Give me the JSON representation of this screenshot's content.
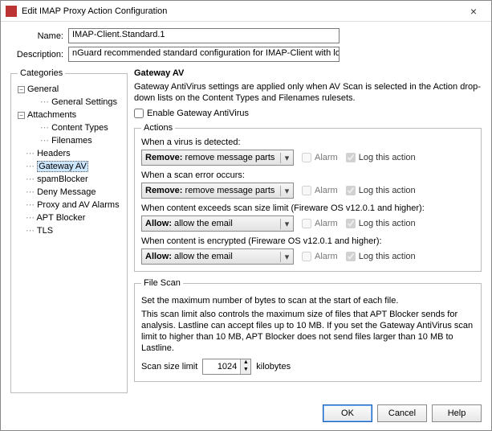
{
  "window": {
    "title": "Edit IMAP Proxy Action Configuration"
  },
  "fields": {
    "name_label": "Name:",
    "name_value": "IMAP-Client.Standard.1",
    "desc_label": "Description:",
    "desc_value": "nGuard recommended standard configuration for IMAP-Client with logging enabled"
  },
  "categories": {
    "legend": "Categories",
    "items": {
      "general": "General",
      "general_settings": "General Settings",
      "attachments": "Attachments",
      "content_types": "Content Types",
      "filenames": "Filenames",
      "headers": "Headers",
      "gateway_av": "Gateway AV",
      "spamblocker": "spamBlocker",
      "deny_message": "Deny Message",
      "proxy_av_alarms": "Proxy and AV Alarms",
      "apt_blocker": "APT Blocker",
      "tls": "TLS"
    }
  },
  "panel": {
    "heading": "Gateway AV",
    "intro": "Gateway AntiVirus settings are applied only when AV Scan is selected in the Action drop-down lists on the Content Types and Filenames rulesets.",
    "enable_label": "Enable Gateway AntiVirus"
  },
  "actions": {
    "legend": "Actions",
    "alarm": "Alarm",
    "log": "Log this action",
    "rows": {
      "virus": {
        "label": "When a virus is detected:",
        "action_strong": "Remove:",
        "action_rest": " remove message parts"
      },
      "error": {
        "label": "When a scan error occurs:",
        "action_strong": "Remove:",
        "action_rest": " remove message parts"
      },
      "size": {
        "label": "When content exceeds scan size limit (Fireware OS v12.0.1 and higher):",
        "action_strong": "Allow:",
        "action_rest": " allow the email"
      },
      "encrypt": {
        "label": "When content is encrypted (Fireware OS v12.0.1 and higher):",
        "action_strong": "Allow:",
        "action_rest": " allow the email"
      }
    }
  },
  "filescan": {
    "legend": "File Scan",
    "line1": "Set the maximum number of bytes to scan at the start of each file.",
    "line2": "This scan limit also controls the maximum size of files that APT Blocker sends for analysis. Lastline can accept files up to 10 MB. If you set the Gateway AntiVirus scan limit to higher than 10 MB, APT Blocker does not send files larger than 10 MB to Lastline.",
    "size_label": "Scan size limit",
    "size_value": "1024",
    "size_unit": "kilobytes"
  },
  "buttons": {
    "ok": "OK",
    "cancel": "Cancel",
    "help": "Help"
  }
}
